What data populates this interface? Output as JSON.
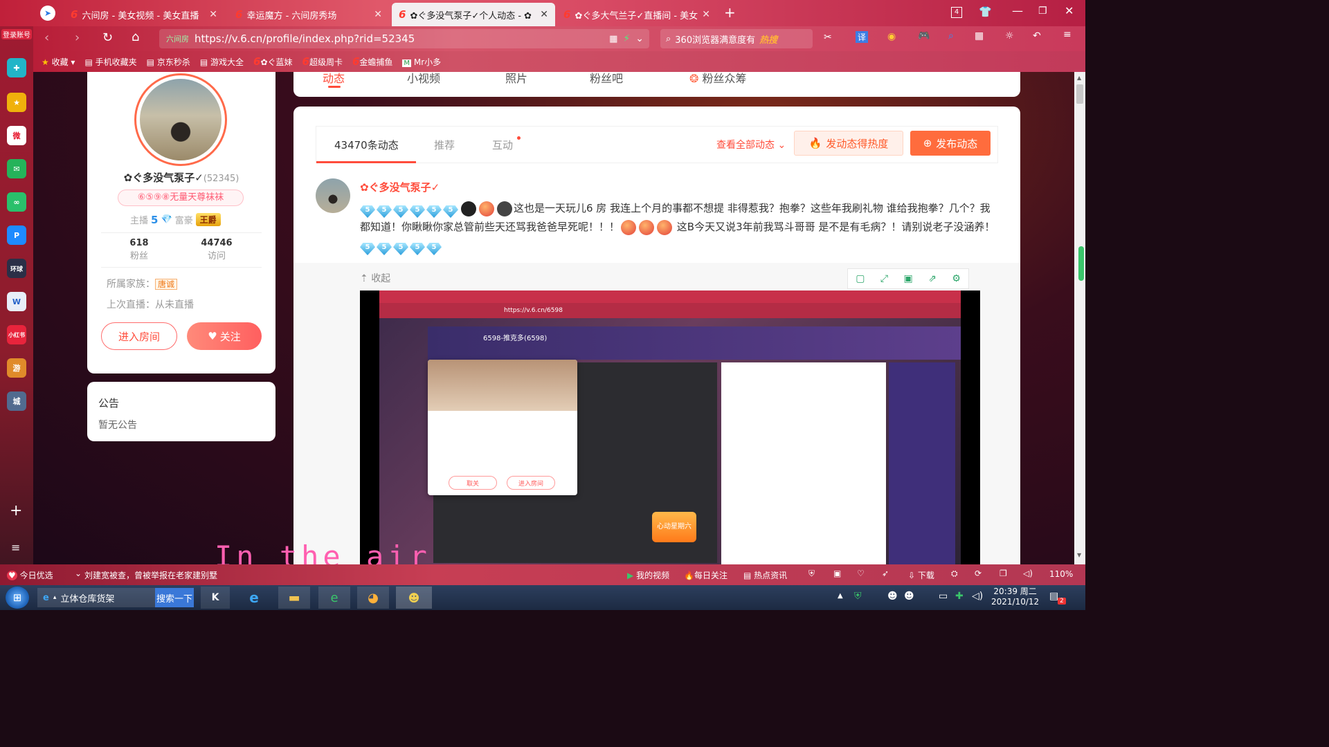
{
  "browser": {
    "tabs": [
      {
        "label": "六间房 - 美女视频 - 美女直播"
      },
      {
        "label": "幸运魔方 - 六间房秀场"
      },
      {
        "label": "✿ぐ多没气泵子✓个人动态 - ✿"
      },
      {
        "label": "✿ぐ多大气兰子✓直播间 - 美女"
      }
    ],
    "tab_count": "4",
    "url_site_label": "六间房",
    "url": "https://v.6.cn/profile/index.php?rid=52345",
    "search_placeholder": "360浏览器满意度有",
    "search_hot": "热搜",
    "bookmarks": [
      "收藏",
      "手机收藏夹",
      "京东秒杀",
      "游戏大全",
      "✿ぐ蓝妹",
      "超级周卡",
      "金蟾捕鱼",
      "Mr小多"
    ],
    "login_label": "登录账号"
  },
  "profile": {
    "name": "✿ぐ多没气泵子✓",
    "rid": "(52345)",
    "badge": "⑥⑤⑨⑧无量天尊袜袜",
    "anchor_label": "主播",
    "anchor_level": "5",
    "rich_label": "富豪",
    "rich_title": "王爵",
    "fans_count": "618",
    "fans_label": "粉丝",
    "visits_count": "44746",
    "visits_label": "访问",
    "family_label": "所属家族：",
    "family_name": "唐诚",
    "last_live": "上次直播：从未直播",
    "enter_room": "进入房间",
    "follow": "关注"
  },
  "notice": {
    "title": "公告",
    "body": "暂无公告"
  },
  "nav_tabs": [
    "动态",
    "小视频",
    "照片",
    "粉丝吧",
    "粉丝众筹"
  ],
  "feed": {
    "tabs": [
      "43470条动态",
      "推荐",
      "互动"
    ],
    "view_all": "查看全部动态",
    "hot_button": "发动态得热度",
    "publish_button": "发布动态",
    "post": {
      "author": "✿ぐ多没气泵子✓",
      "text1": "这也是一天玩儿6 房 我连上个月的事都不想提 非得惹我？抱拳？这些年我刷礼物 谁给我抱拳？几个？我都知道！你瞅瞅你家总管前些天还骂我爸爸早死呢！！！",
      "text2": "这B今天又说3年前我骂斗哥哥 是不是有毛病？！请别说老子没涵养！",
      "collapse": "收起"
    }
  },
  "embedded": {
    "url": "https://v.6.cn/6598",
    "room_title": "6598-推克多(6598)",
    "popup_btn1": "取关",
    "popup_btn2": "进入房间",
    "weekly_label": "心动星期六"
  },
  "overlay_text": "In the air",
  "statusbar": {
    "today": "今日优选",
    "news": "刘建宽被查，曾被举报在老家建别墅",
    "my_video": "我的视频",
    "daily": "每日关注",
    "hot_news": "热点资讯",
    "download": "下载",
    "zoom": "110%"
  },
  "taskbar": {
    "task1": "立体仓库货架",
    "search_btn": "搜索一下",
    "time": "20:39 周二",
    "date": "2021/10/12",
    "notif_count": "2"
  },
  "colors": {
    "brand_red": "#ff4c3b",
    "accent_orange": "#ff6c3d",
    "tab_active": "#f3eef0"
  }
}
